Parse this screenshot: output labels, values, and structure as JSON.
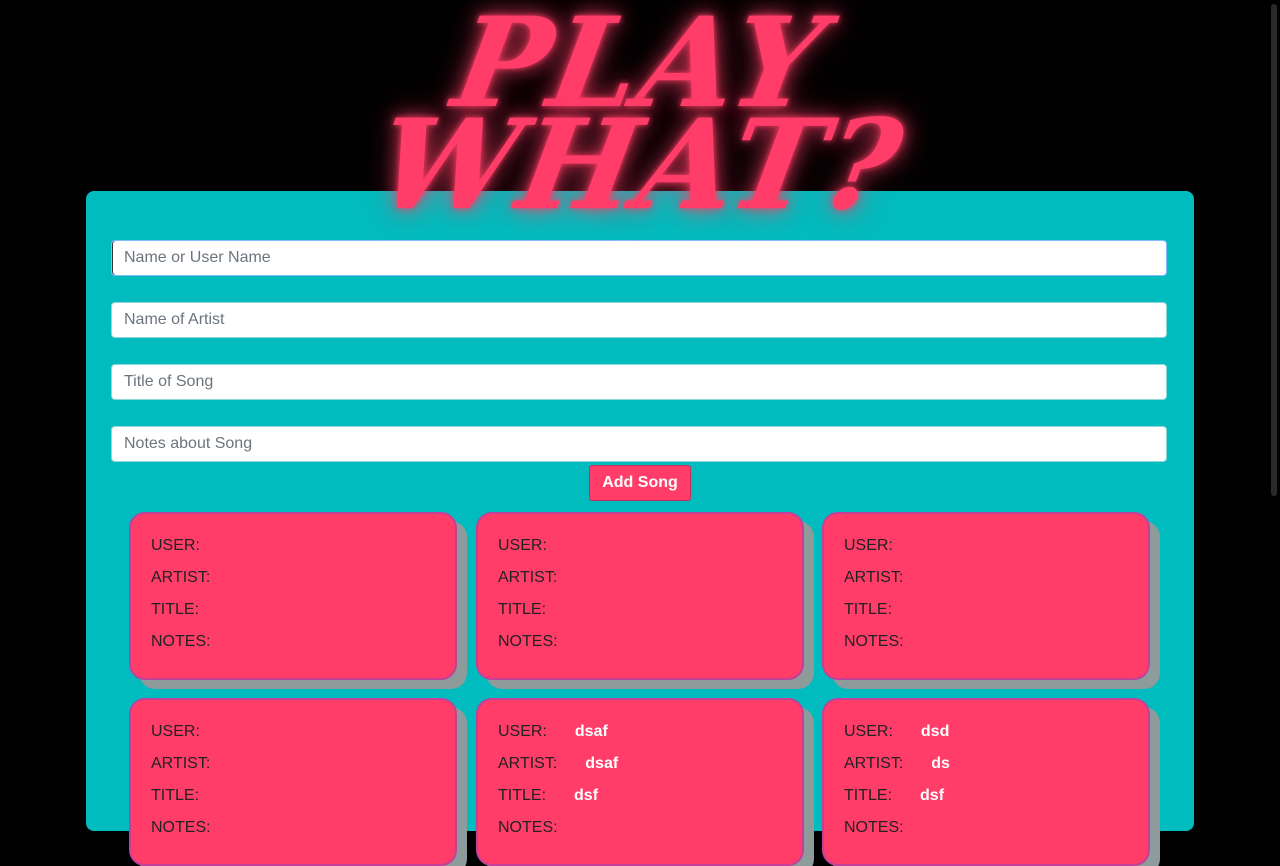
{
  "header": {
    "logo_line1": "PLAY",
    "logo_line2": "WHAT?"
  },
  "form": {
    "user_placeholder": "Name or User Name",
    "artist_placeholder": "Name of Artist",
    "title_placeholder": "Title of Song",
    "notes_placeholder": "Notes about Song",
    "submit_label": "Add Song"
  },
  "labels": {
    "user": "USER:",
    "artist": "ARTIST:",
    "title": "TITLE:",
    "notes": "NOTES:"
  },
  "songs": [
    {
      "user": "",
      "artist": "",
      "title": "",
      "notes": ""
    },
    {
      "user": "",
      "artist": "",
      "title": "",
      "notes": ""
    },
    {
      "user": "",
      "artist": "",
      "title": "",
      "notes": ""
    },
    {
      "user": "",
      "artist": "",
      "title": "",
      "notes": ""
    },
    {
      "user": "dsaf",
      "artist": "dsaf",
      "title": "dsf",
      "notes": ""
    },
    {
      "user": "dsd",
      "artist": "ds",
      "title": "dsf",
      "notes": ""
    }
  ],
  "colors": {
    "background": "#000000",
    "panel": "#00bcbe",
    "accent": "#ff3d68",
    "card_shadow": "#8d9b9b"
  }
}
